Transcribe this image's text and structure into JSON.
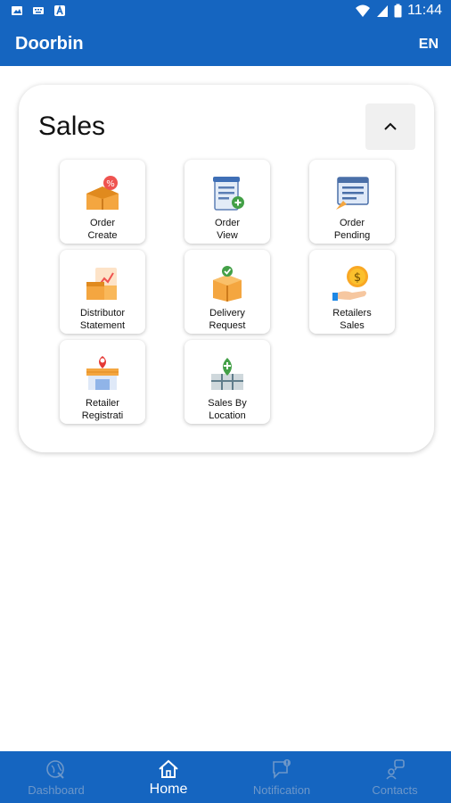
{
  "status_bar": {
    "time": "11:44"
  },
  "app_bar": {
    "title": "Doorbin",
    "language": "EN"
  },
  "sales": {
    "title": "Sales",
    "tiles": [
      {
        "label": "Order\nCreate",
        "icon": "order-create-icon"
      },
      {
        "label": "Order\nView",
        "icon": "order-view-icon"
      },
      {
        "label": "Order\nPending",
        "icon": "order-pending-icon"
      },
      {
        "label": "Distributor\nStatement",
        "icon": "distributor-statement-icon"
      },
      {
        "label": "Delivery\nRequest",
        "icon": "delivery-request-icon"
      },
      {
        "label": "Retailers\nSales",
        "icon": "retailers-sales-icon"
      },
      {
        "label": "Retailer\nRegistrati",
        "icon": "retailer-registration-icon"
      },
      {
        "label": "Sales By\nLocation",
        "icon": "sales-by-location-icon"
      }
    ]
  },
  "bottom_nav": [
    {
      "label": "Dashboard",
      "icon": "dashboard-icon",
      "active": false
    },
    {
      "label": "Home",
      "icon": "home-icon",
      "active": true
    },
    {
      "label": "Notification",
      "icon": "notification-icon",
      "active": false
    },
    {
      "label": "Contacts",
      "icon": "contacts-icon",
      "active": false
    }
  ],
  "colors": {
    "primary": "#1565c0",
    "inactive_nav": "#6d97c9",
    "card_bg": "#ffffff"
  }
}
